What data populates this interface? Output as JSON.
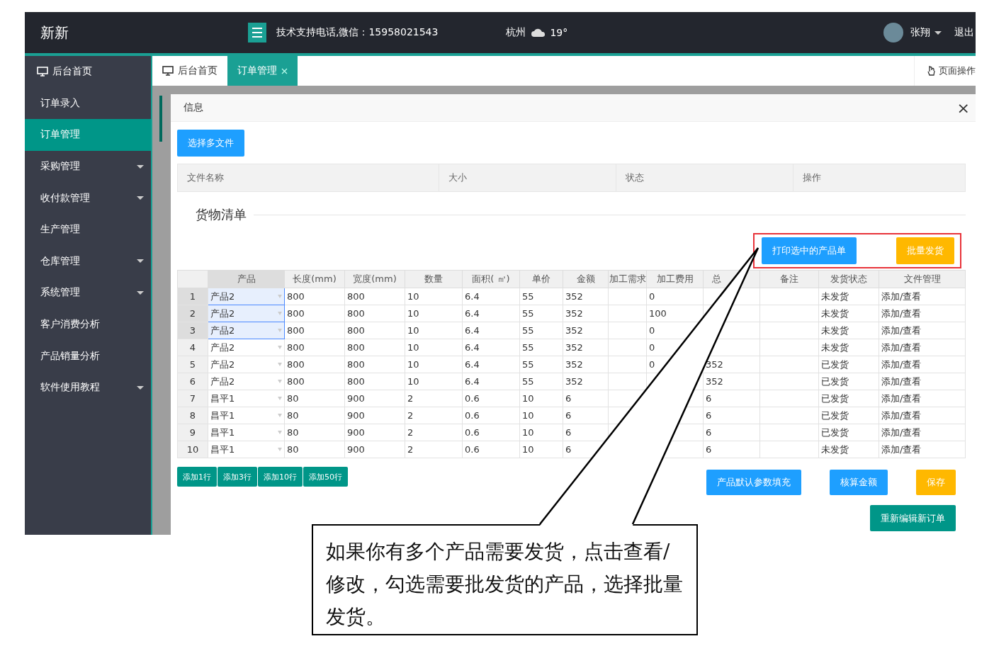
{
  "header": {
    "brand": "新新",
    "support": "技术支持电话,微信：15958021543",
    "city": "杭州",
    "temperature": "19°",
    "user": "张翔",
    "logout": "退出"
  },
  "sidebar": {
    "items": [
      {
        "label": "后台首页",
        "kind": "home",
        "selected": false,
        "expandable": false
      },
      {
        "label": "订单录入",
        "kind": "plain",
        "selected": false,
        "expandable": false
      },
      {
        "label": "订单管理",
        "kind": "plain",
        "selected": true,
        "expandable": false
      },
      {
        "label": "采购管理",
        "kind": "plain",
        "selected": false,
        "expandable": true
      },
      {
        "label": "收付款管理",
        "kind": "plain",
        "selected": false,
        "expandable": true
      },
      {
        "label": "生产管理",
        "kind": "plain",
        "selected": false,
        "expandable": false
      },
      {
        "label": "仓库管理",
        "kind": "plain",
        "selected": false,
        "expandable": true
      },
      {
        "label": "系统管理",
        "kind": "plain",
        "selected": false,
        "expandable": true
      },
      {
        "label": "客户消费分析",
        "kind": "plain",
        "selected": false,
        "expandable": false
      },
      {
        "label": "产品销量分析",
        "kind": "plain",
        "selected": false,
        "expandable": false
      },
      {
        "label": "软件使用教程",
        "kind": "plain",
        "selected": false,
        "expandable": true
      }
    ]
  },
  "tabs": [
    {
      "label": "后台首页",
      "kind": "home",
      "selected": false,
      "closable": false
    },
    {
      "label": "订单管理",
      "kind": "plain",
      "selected": true,
      "closable": true
    }
  ],
  "page_action": "页面操作",
  "dialog": {
    "title": "信息",
    "close": "×",
    "upload_button": "选择多文件",
    "file_columns": [
      "文件名称",
      "大小",
      "状态",
      "操作"
    ],
    "section_title": "货物清单",
    "highlight_buttons": [
      {
        "label": "打印选中的产品单",
        "kind": "primary"
      },
      {
        "label": "批量发货",
        "kind": "warning"
      }
    ],
    "grid": {
      "columns": [
        "产品",
        "长度(mm)",
        "宽度(mm)",
        "数量",
        "面积( ㎡)",
        "单价",
        "金额",
        "加工需求",
        "加工费用",
        "总",
        "备注",
        "发货状态",
        "文件管理"
      ],
      "rows": [
        {
          "index": "1",
          "selected": true,
          "cells": [
            "产品2",
            "800",
            "800",
            "10",
            "6.4",
            "55",
            "352",
            "",
            "0",
            "",
            "",
            "未发货",
            "添加/查看"
          ]
        },
        {
          "index": "2",
          "selected": true,
          "cells": [
            "产品2",
            "800",
            "800",
            "10",
            "6.4",
            "55",
            "352",
            "",
            "100",
            "",
            "",
            "未发货",
            "添加/查看"
          ]
        },
        {
          "index": "3",
          "selected": true,
          "cells": [
            "产品2",
            "800",
            "800",
            "10",
            "6.4",
            "55",
            "352",
            "",
            "0",
            "",
            "",
            "未发货",
            "添加/查看"
          ]
        },
        {
          "index": "4",
          "selected": false,
          "cells": [
            "产品2",
            "800",
            "800",
            "10",
            "6.4",
            "55",
            "352",
            "",
            "0",
            "",
            "",
            "未发货",
            "添加/查看"
          ]
        },
        {
          "index": "5",
          "selected": false,
          "cells": [
            "产品2",
            "800",
            "800",
            "10",
            "6.4",
            "55",
            "352",
            "",
            "0",
            "352",
            "",
            "已发货",
            "添加/查看"
          ]
        },
        {
          "index": "6",
          "selected": false,
          "cells": [
            "产品2",
            "800",
            "800",
            "10",
            "6.4",
            "55",
            "352",
            "",
            "",
            "352",
            "",
            "已发货",
            "添加/查看"
          ]
        },
        {
          "index": "7",
          "selected": false,
          "cells": [
            "昌平1",
            "80",
            "900",
            "2",
            "0.6",
            "10",
            "6",
            "",
            "",
            "6",
            "",
            "已发货",
            "添加/查看"
          ]
        },
        {
          "index": "8",
          "selected": false,
          "cells": [
            "昌平1",
            "80",
            "900",
            "2",
            "0.6",
            "10",
            "6",
            "",
            "",
            "6",
            "",
            "已发货",
            "添加/查看"
          ]
        },
        {
          "index": "9",
          "selected": false,
          "cells": [
            "昌平1",
            "80",
            "900",
            "2",
            "0.6",
            "10",
            "6",
            "",
            "",
            "6",
            "",
            "已发货",
            "添加/查看"
          ]
        },
        {
          "index": "10",
          "selected": false,
          "cells": [
            "昌平1",
            "80",
            "900",
            "2",
            "0.6",
            "10",
            "6",
            "",
            "",
            "6",
            "",
            "未发货",
            "添加/查看"
          ]
        }
      ]
    },
    "add_row_buttons": [
      "添加1行",
      "添加3行",
      "添加10行",
      "添加50行"
    ],
    "action_buttons": [
      {
        "label": "产品默认参数填充",
        "kind": "primary"
      },
      {
        "label": "核算金额",
        "kind": "primary"
      },
      {
        "label": "保存",
        "kind": "warning"
      }
    ],
    "reedit_button": "重新编辑新订单"
  },
  "callout": {
    "text": "如果你有多个产品需要发货，点击查看/修改，勾选需要批发货的产品，选择批量发货。"
  }
}
